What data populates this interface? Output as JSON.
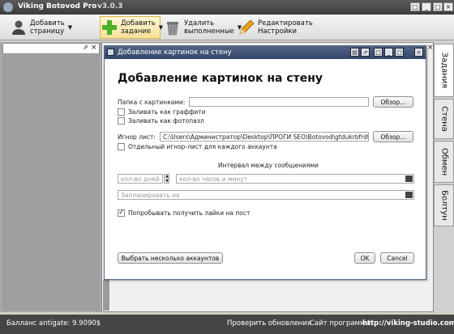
{
  "window": {
    "title": "Viking Botovod Pro",
    "version": "v3.0.3",
    "controls": [
      "□",
      "_",
      "□",
      "×"
    ]
  },
  "toolbar": [
    {
      "label": "Добавить\nстраницу",
      "icon": "user-add-icon"
    },
    {
      "label": "Добавить\nзадание",
      "icon": "plus-icon"
    },
    {
      "label": "Удалить\nвыполненные",
      "icon": "trash-icon"
    },
    {
      "label": "Редактировать\nНастройки",
      "icon": "pencil-icon"
    }
  ],
  "left_panel": {
    "pin": "⇗",
    "close": "×"
  },
  "side_tabs": [
    "Задания",
    "Стена",
    "Обмен",
    "Болтун"
  ],
  "dialog": {
    "title": "Добавление картинок на стену",
    "heading": "Добавление картинок на стену",
    "folder_label": "Папка с картинками:",
    "folder_value": "",
    "browse1": "Обзор...",
    "graffiti": "Заливать как граффити",
    "puzzle": "Заливать как фотопазл",
    "ignore_label": "Игнор лист:",
    "ignore_value": "C:\\Users\\Администратор\\Desktop\\ПРОГИ SEO\\Botovod\\gtdukrbfrdt",
    "browse2": "Обзор...",
    "separate_ignore": "Отдельный игнор-лист для каждого аккаунта",
    "interval_label": "Интервал между сообщениями",
    "days_placeholder": "кол-во дней",
    "hours_placeholder": "кол-во часов и минут",
    "schedule_placeholder": "Запланировать на",
    "likes": "Попробывать получить лайки на пост",
    "likes_checked": true,
    "select_accounts": "Выбрать несколько аккаунтов",
    "ok": "OK",
    "cancel": "Cancel"
  },
  "status": {
    "balance": "Балланс antigate: 9.9090$",
    "updates": "Проверить обновления",
    "site_label": "Сайт программы:",
    "site_url": "http://viking-studio.com"
  }
}
